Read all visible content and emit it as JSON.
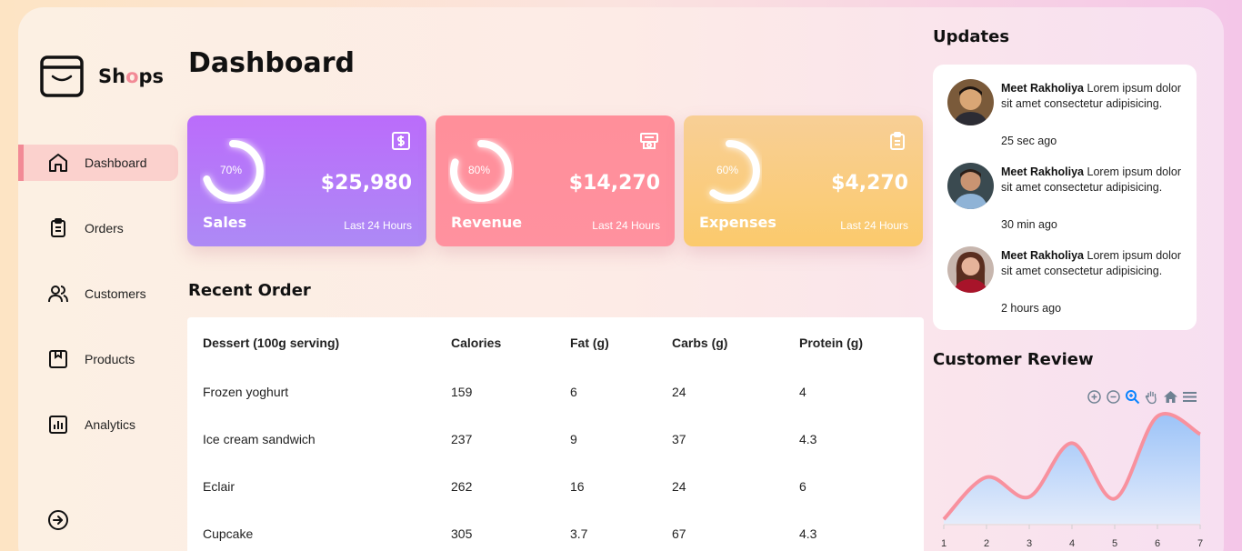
{
  "brand": {
    "prefix": "Sh",
    "o": "o",
    "suffix": "ps"
  },
  "sidebar": {
    "items": [
      {
        "label": "Dashboard",
        "icon": "home-icon",
        "active": true
      },
      {
        "label": "Orders",
        "icon": "clipboard-icon"
      },
      {
        "label": "Customers",
        "icon": "users-icon"
      },
      {
        "label": "Products",
        "icon": "box-icon"
      },
      {
        "label": "Analytics",
        "icon": "bar-chart-icon"
      }
    ],
    "logout_icon": "logout-icon"
  },
  "page_title": "Dashboard",
  "cards": [
    {
      "name": "Sales",
      "percent_label": "70%",
      "percent": 70,
      "amount": "$25,980",
      "sub": "Last 24 Hours",
      "icon": "dollar-icon"
    },
    {
      "name": "Revenue",
      "percent_label": "80%",
      "percent": 80,
      "amount": "$14,270",
      "sub": "Last 24 Hours",
      "icon": "cash-register-icon"
    },
    {
      "name": "Expenses",
      "percent_label": "60%",
      "percent": 60,
      "amount": "$4,270",
      "sub": "Last 24 Hours",
      "icon": "clipboard-icon"
    }
  ],
  "recent_order": {
    "title": "Recent Order",
    "columns": [
      "Dessert (100g serving)",
      "Calories",
      "Fat (g)",
      "Carbs (g)",
      "Protein (g)"
    ],
    "rows": [
      [
        "Frozen yoghurt",
        "159",
        "6",
        "24",
        "4"
      ],
      [
        "Ice cream sandwich",
        "237",
        "9",
        "37",
        "4.3"
      ],
      [
        "Eclair",
        "262",
        "16",
        "24",
        "6"
      ],
      [
        "Cupcake",
        "305",
        "3.7",
        "67",
        "4.3"
      ]
    ]
  },
  "updates": {
    "title": "Updates",
    "items": [
      {
        "name": "Meet Rakholiya",
        "text": "Lorem ipsum dolor sit amet consectetur adipisicing.",
        "time": "25 sec ago"
      },
      {
        "name": "Meet Rakholiya",
        "text": "Lorem ipsum dolor sit amet consectetur adipisicing.",
        "time": "30 min ago"
      },
      {
        "name": "Meet Rakholiya",
        "text": "Lorem ipsum dolor sit amet consectetur adipisicing.",
        "time": "2 hours ago"
      }
    ]
  },
  "customer_review": {
    "title": "Customer Review",
    "toolbar": [
      "zoom-in-icon",
      "zoom-out-icon",
      "zoom-select-icon",
      "pan-hand-icon",
      "home-icon",
      "menu-icon"
    ]
  },
  "chart_data": {
    "type": "area",
    "x": [
      1,
      2,
      3,
      4,
      5,
      6,
      7
    ],
    "values": [
      5,
      52,
      30,
      90,
      28,
      120,
      100
    ],
    "ylim": [
      0,
      130
    ],
    "xlabel": "",
    "ylabel": "",
    "colors": {
      "line": "#f8919e",
      "fill_top": "#9cc3f8",
      "fill_bottom": "#e4ecfb"
    }
  }
}
